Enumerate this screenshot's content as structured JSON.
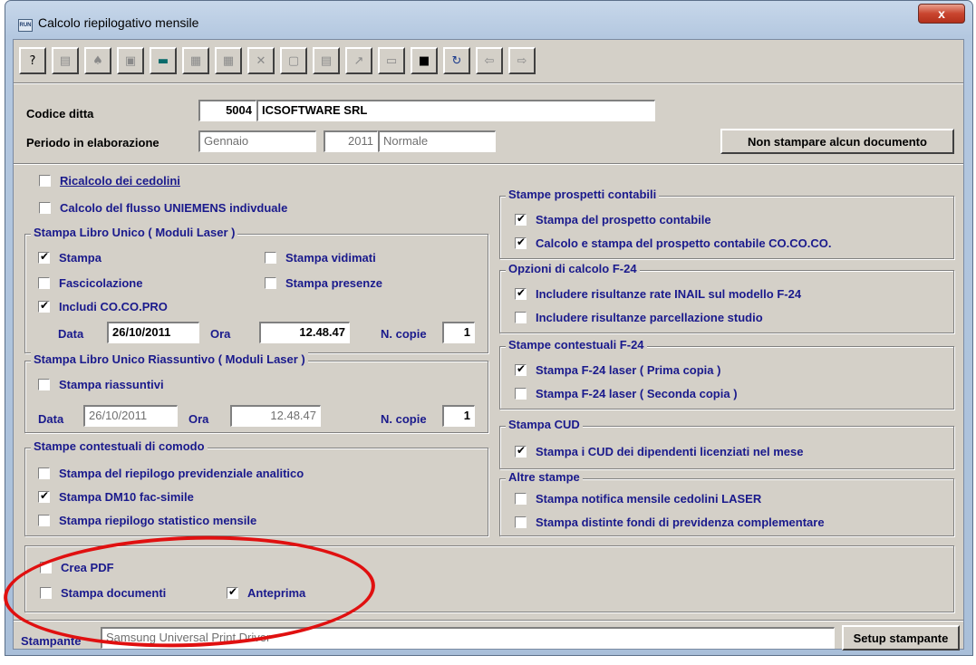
{
  "window": {
    "title": "Calcolo riepilogativo mensile",
    "app_icon_text": "RUN",
    "close_glyph": "x"
  },
  "toolbar": {
    "buttons": [
      {
        "name": "help-icon",
        "glyph": "?"
      },
      {
        "name": "properties-icon",
        "glyph": "▤"
      },
      {
        "name": "find-icon",
        "glyph": "♠"
      },
      {
        "name": "copy-record-icon",
        "glyph": "▣"
      },
      {
        "name": "calculator-icon",
        "glyph": "▬"
      },
      {
        "name": "paste-icon",
        "glyph": "▦"
      },
      {
        "name": "grid-icon",
        "glyph": "▦"
      },
      {
        "name": "delete-icon",
        "glyph": "✕"
      },
      {
        "name": "preview-icon",
        "glyph": "▢"
      },
      {
        "name": "print-icon",
        "glyph": "▤"
      },
      {
        "name": "export-icon",
        "glyph": "↗"
      },
      {
        "name": "edit-icon",
        "glyph": "▭"
      },
      {
        "name": "save-icon",
        "glyph": "■"
      },
      {
        "name": "refresh-icon",
        "glyph": "↻"
      },
      {
        "name": "back-icon",
        "glyph": "⇦"
      },
      {
        "name": "forward-icon",
        "glyph": "⇨"
      }
    ]
  },
  "header": {
    "codice_ditta_label": "Codice ditta",
    "codice_ditta_value": "5004",
    "ditta_name": "ICSOFTWARE SRL",
    "periodo_label": "Periodo in elaborazione",
    "mese": "Gennaio",
    "anno": "2011",
    "tipo": "Normale",
    "non_stampare_button": "Non stampare alcun documento"
  },
  "left": {
    "ricalcolo": "Ricalcolo dei cedolini",
    "uniemens": "Calcolo del flusso UNIEMENS indivduale",
    "libro_unico": {
      "title": "Stampa Libro Unico ( Moduli Laser )",
      "stampa": "Stampa",
      "stampa_vidimati": "Stampa vidimati",
      "fascicolazione": "Fascicolazione",
      "stampa_presenze": "Stampa presenze",
      "includi": "Includi CO.CO.PRO",
      "data_label": "Data",
      "data_value": "26/10/2011",
      "ora_label": "Ora",
      "ora_value": "12.48.47",
      "copie_label": "N. copie",
      "copie_value": "1"
    },
    "riassuntivo": {
      "title": "Stampa Libro Unico Riassuntivo ( Moduli Laser )",
      "stampa_riassuntivi": "Stampa riassuntivi",
      "data_label": "Data",
      "data_value": "26/10/2011",
      "ora_label": "Ora",
      "ora_value": "12.48.47",
      "copie_label": "N. copie",
      "copie_value": "1"
    },
    "comodo": {
      "title": "Stampe contestuali di comodo",
      "riepilogo": "Stampa del riepilogo previdenziale analitico",
      "dm10": "Stampa DM10 fac-simile",
      "statistico": "Stampa riepilogo statistico mensile"
    }
  },
  "right": {
    "contabili": {
      "title": "Stampe prospetti contabili",
      "prospetto": "Stampa del prospetto contabile",
      "cococo": "Calcolo e stampa del prospetto contabile CO.CO.CO."
    },
    "f24_opzioni": {
      "title": "Opzioni di calcolo F-24",
      "inail": "Includere risultanze rate INAIL sul modello F-24",
      "parcellazione": "Includere risultanze parcellazione studio"
    },
    "f24_contestuali": {
      "title": "Stampe contestuali F-24",
      "prima": "Stampa F-24 laser ( Prima copia )",
      "seconda": "Stampa F-24 laser ( Seconda copia )"
    },
    "cud": {
      "title": "Stampa CUD",
      "licenziati": "Stampa i CUD dei dipendenti licenziati nel mese"
    },
    "altre": {
      "title": "Altre stampe",
      "notifica": "Stampa notifica mensile cedolini LASER",
      "distinte": "Stampa distinte fondi di previdenza complementare"
    }
  },
  "bottom": {
    "crea_pdf": "Crea PDF",
    "stampa_documenti": "Stampa documenti",
    "anteprima": "Anteprima"
  },
  "printer": {
    "label": "Stampante",
    "value": "Samsung Universal Print Driver",
    "setup_button": "Setup stampante"
  },
  "colors": {
    "group_title": "#1a1a8c",
    "annotation_ellipse": "#e01010"
  }
}
